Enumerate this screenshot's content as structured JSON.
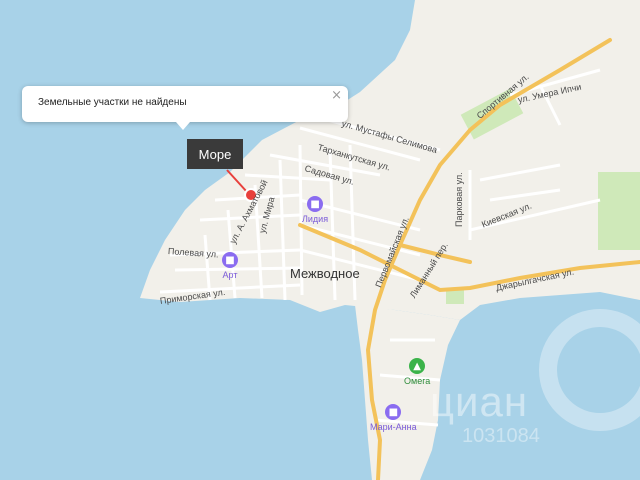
{
  "map": {
    "popup": {
      "text": "Земельные участки не найдены",
      "close_icon": "close-icon"
    },
    "sea_label": "Море",
    "town": "Межводное",
    "streets": {
      "sportivnaya": "Спортивная ул.",
      "umera_ipchi": "ул. Умера Ипчи",
      "mustafy_selimova": "ул. Мустафы Селимова",
      "tarkhankutskaya": "Тарханкутская ул.",
      "sadovaya": "Садовая ул.",
      "a_akhmatovoy": "ул. А. Ахматовой",
      "mira": "ул. Мира",
      "parkovaya": "Парковая ул.",
      "kievskaya": "Киевская ул.",
      "pervomayskaya": "Первомайская ул.",
      "polevaya": "Полевая ул.",
      "primorskaya": "Приморская ул.",
      "limannyy": "Лиманный пер.",
      "dzharylgachskaya": "Джарылгачская ул."
    },
    "pois": [
      {
        "name": "Лидия",
        "icon": "bed-icon",
        "color": "#8a6cf0"
      },
      {
        "name": "Арт",
        "icon": "bed-icon",
        "color": "#8a6cf0"
      },
      {
        "name": "Омега",
        "icon": "shopping-cart-icon",
        "color": "#3bb34a"
      },
      {
        "name": "Мари-Анна",
        "icon": "bed-icon",
        "color": "#8a6cf0"
      }
    ],
    "watermark": {
      "text": "циан",
      "id": "1031084"
    },
    "colors": {
      "sea": "#a8d2e8",
      "land": "#f2f0ea",
      "road": "#f3c25a",
      "park": "#cfe9b9",
      "marker": "#e8403c"
    }
  }
}
